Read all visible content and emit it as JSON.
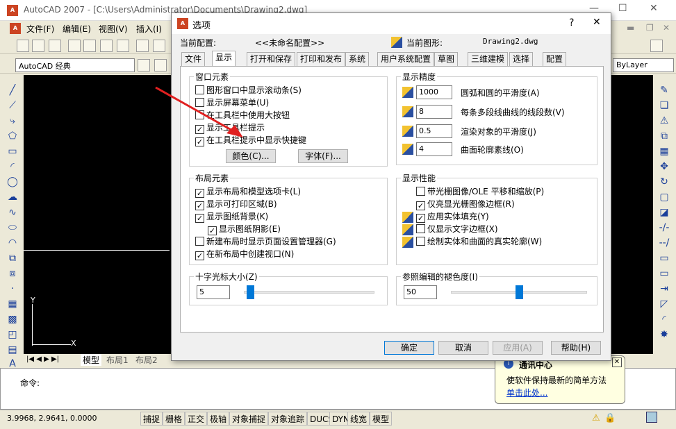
{
  "app": {
    "title": "AutoCAD 2007 - [C:\\Users\\Administrator\\Documents\\Drawing2.dwg]",
    "menus": [
      "文件(F)",
      "编辑(E)",
      "视图(V)",
      "插入(I)"
    ],
    "workspace": "AutoCAD 经典",
    "layer_combo": "ByLayer",
    "axis_y": "Y",
    "axis_x": "X",
    "layout_tabs": [
      "模型",
      "布局1",
      "布局2"
    ],
    "cmd_label": "命令:",
    "coords": "3.9968, 2.9641, 0.0000",
    "status_buttons": [
      "捕捉",
      "栅格",
      "正交",
      "极轴",
      "对象捕捉",
      "对象追踪",
      "DUCS",
      "DYN",
      "线宽",
      "模型"
    ]
  },
  "tooltip": {
    "title": "通讯中心",
    "body": "使软件保持最新的简单方法",
    "link": "单击此处..."
  },
  "dialog": {
    "title": "选项",
    "current_config_label": "当前配置:",
    "current_config": "<<未命名配置>>",
    "current_drawing_label": "当前图形:",
    "current_drawing": "Drawing2.dwg",
    "tabs": [
      "文件",
      "显示",
      "打开和保存",
      "打印和发布",
      "系统",
      "用户系统配置",
      "草图",
      "三维建模",
      "选择",
      "配置"
    ],
    "window_elements": {
      "title": "窗口元素",
      "items": [
        {
          "label": "图形窗口中显示滚动条(S)",
          "checked": false
        },
        {
          "label": "显示屏幕菜单(U)",
          "checked": false
        },
        {
          "label": "在工具栏中使用大按钮",
          "checked": false
        },
        {
          "label": "显示工具栏提示",
          "checked": true
        },
        {
          "label": "在工具栏提示中显示快捷键",
          "checked": true
        }
      ],
      "color_btn": "颜色(C)...",
      "font_btn": "字体(F)..."
    },
    "layout_elements": {
      "title": "布局元素",
      "items": [
        {
          "label": "显示布局和模型选项卡(L)",
          "checked": true
        },
        {
          "label": "显示可打印区域(B)",
          "checked": true
        },
        {
          "label": "显示图纸背景(K)",
          "checked": true
        },
        {
          "label": "显示图纸阴影(E)",
          "checked": true
        },
        {
          "label": "新建布局时显示页面设置管理器(G)",
          "checked": false
        },
        {
          "label": "在新布局中创建视口(N)",
          "checked": true
        }
      ]
    },
    "crosshair": {
      "title": "十字光标大小(Z)",
      "value": "5",
      "level": 5
    },
    "precision": {
      "title": "显示精度",
      "items": [
        {
          "value": "1000",
          "label": "圆弧和圆的平滑度(A)"
        },
        {
          "value": "8",
          "label": "每条多段线曲线的线段数(V)"
        },
        {
          "value": "0.5",
          "label": "渲染对象的平滑度(J)"
        },
        {
          "value": "4",
          "label": "曲面轮廓素线(O)"
        }
      ]
    },
    "performance": {
      "title": "显示性能",
      "items": [
        {
          "label": "带光栅图像/OLE 平移和缩放(P)",
          "checked": false
        },
        {
          "label": "仅亮显光栅图像边框(R)",
          "checked": true
        },
        {
          "label": "应用实体填充(Y)",
          "checked": true
        },
        {
          "label": "仅显示文字边框(X)",
          "checked": false
        },
        {
          "label": "绘制实体和曲面的真实轮廓(W)",
          "checked": false
        }
      ]
    },
    "xref_fade": {
      "title": "参照编辑的褪色度(I)",
      "value": "50",
      "level": 50
    },
    "buttons": {
      "ok": "确定",
      "cancel": "取消",
      "apply": "应用(A)",
      "help": "帮助(H)"
    }
  },
  "colors": {
    "accent": "#0078d7",
    "arrow": "#e02020"
  }
}
